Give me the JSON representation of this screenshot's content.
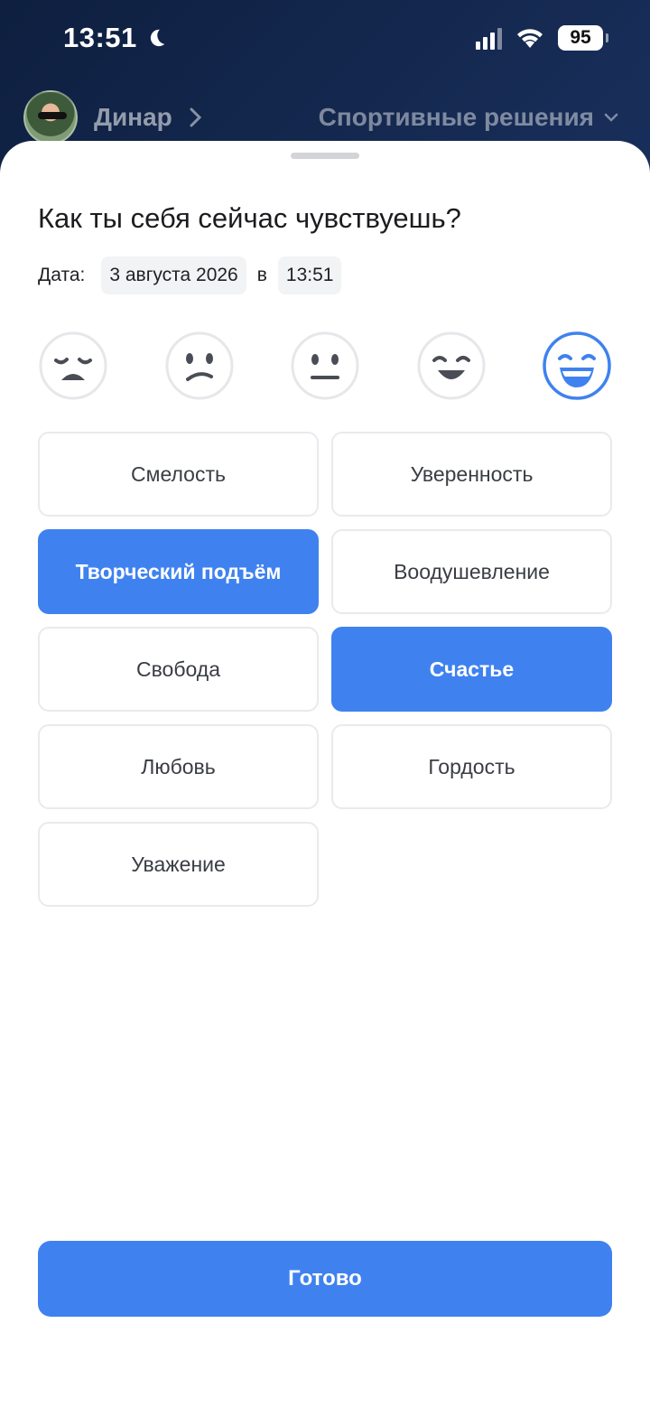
{
  "status_bar": {
    "time": "13:51",
    "battery": "95"
  },
  "header": {
    "user_name": "Динар",
    "project": "Спортивные решения"
  },
  "sheet": {
    "title": "Как ты себя сейчас чувствуешь?",
    "date_label": "Дата:",
    "date_value": "3 августа 2026",
    "at": "в",
    "time_value": "13:51",
    "moods": [
      "very-sad",
      "sad",
      "neutral",
      "happy",
      "very-happy"
    ],
    "selected_mood": "very-happy",
    "accent_color": "#3f82ef",
    "tags": [
      {
        "label": "Смелость",
        "selected": false
      },
      {
        "label": "Уверенность",
        "selected": false
      },
      {
        "label": "Творческий подъём",
        "selected": true
      },
      {
        "label": "Воодушевление",
        "selected": false
      },
      {
        "label": "Свобода",
        "selected": false
      },
      {
        "label": "Счастье",
        "selected": true
      },
      {
        "label": "Любовь",
        "selected": false
      },
      {
        "label": "Гордость",
        "selected": false
      },
      {
        "label": "Уважение",
        "selected": false
      }
    ],
    "done_label": "Готово"
  }
}
